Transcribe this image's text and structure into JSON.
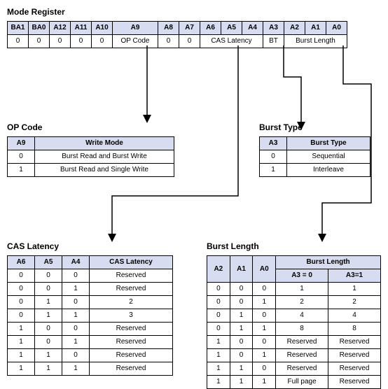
{
  "mode_register": {
    "title": "Mode Register",
    "headers": [
      "BA1",
      "BA0",
      "A12",
      "A11",
      "A10",
      "A9",
      "A8",
      "A7",
      "A6",
      "A5",
      "A4",
      "A3",
      "A2",
      "A1",
      "A0"
    ],
    "row": {
      "ba1": "0",
      "ba0": "0",
      "a12": "0",
      "a11": "0",
      "a10": "0",
      "a9": "OP Code",
      "a8": "0",
      "a7": "0",
      "cas": "CAS Latency",
      "bt": "BT",
      "bl": "Burst Length"
    }
  },
  "opcode": {
    "title": "OP Code",
    "headers": [
      "A9",
      "Write Mode"
    ],
    "rows": [
      {
        "a9": "0",
        "mode": "Burst Read and Burst Write"
      },
      {
        "a9": "1",
        "mode": "Burst Read and Single Write"
      }
    ]
  },
  "burst_type": {
    "title": "Burst Type",
    "headers": [
      "A3",
      "Burst Type"
    ],
    "rows": [
      {
        "a3": "0",
        "type": "Sequential"
      },
      {
        "a3": "1",
        "type": "Interleave"
      }
    ]
  },
  "cas_latency": {
    "title": "CAS Latency",
    "headers": [
      "A6",
      "A5",
      "A4",
      "CAS Latency"
    ],
    "rows": [
      {
        "a6": "0",
        "a5": "0",
        "a4": "0",
        "val": "Reserved"
      },
      {
        "a6": "0",
        "a5": "0",
        "a4": "1",
        "val": "Reserved"
      },
      {
        "a6": "0",
        "a5": "1",
        "a4": "0",
        "val": "2"
      },
      {
        "a6": "0",
        "a5": "1",
        "a4": "1",
        "val": "3"
      },
      {
        "a6": "1",
        "a5": "0",
        "a4": "0",
        "val": "Reserved"
      },
      {
        "a6": "1",
        "a5": "0",
        "a4": "1",
        "val": "Reserved"
      },
      {
        "a6": "1",
        "a5": "1",
        "a4": "0",
        "val": "Reserved"
      },
      {
        "a6": "1",
        "a5": "1",
        "a4": "1",
        "val": "Reserved"
      }
    ]
  },
  "burst_length": {
    "title": "Burst Length",
    "headers": {
      "a2": "A2",
      "a1": "A1",
      "a0": "A0",
      "grp": "Burst Length",
      "c0": "A3 = 0",
      "c1": "A3=1"
    },
    "rows": [
      {
        "a2": "0",
        "a1": "0",
        "a0": "0",
        "c0": "1",
        "c1": "1"
      },
      {
        "a2": "0",
        "a1": "0",
        "a0": "1",
        "c0": "2",
        "c1": "2"
      },
      {
        "a2": "0",
        "a1": "1",
        "a0": "0",
        "c0": "4",
        "c1": "4"
      },
      {
        "a2": "0",
        "a1": "1",
        "a0": "1",
        "c0": "8",
        "c1": "8"
      },
      {
        "a2": "1",
        "a1": "0",
        "a0": "0",
        "c0": "Reserved",
        "c1": "Reserved"
      },
      {
        "a2": "1",
        "a1": "0",
        "a0": "1",
        "c0": "Reserved",
        "c1": "Reserved"
      },
      {
        "a2": "1",
        "a1": "1",
        "a0": "0",
        "c0": "Reserved",
        "c1": "Reserved"
      },
      {
        "a2": "1",
        "a1": "1",
        "a0": "1",
        "c0": "Full page",
        "c1": "Reserved"
      }
    ]
  }
}
